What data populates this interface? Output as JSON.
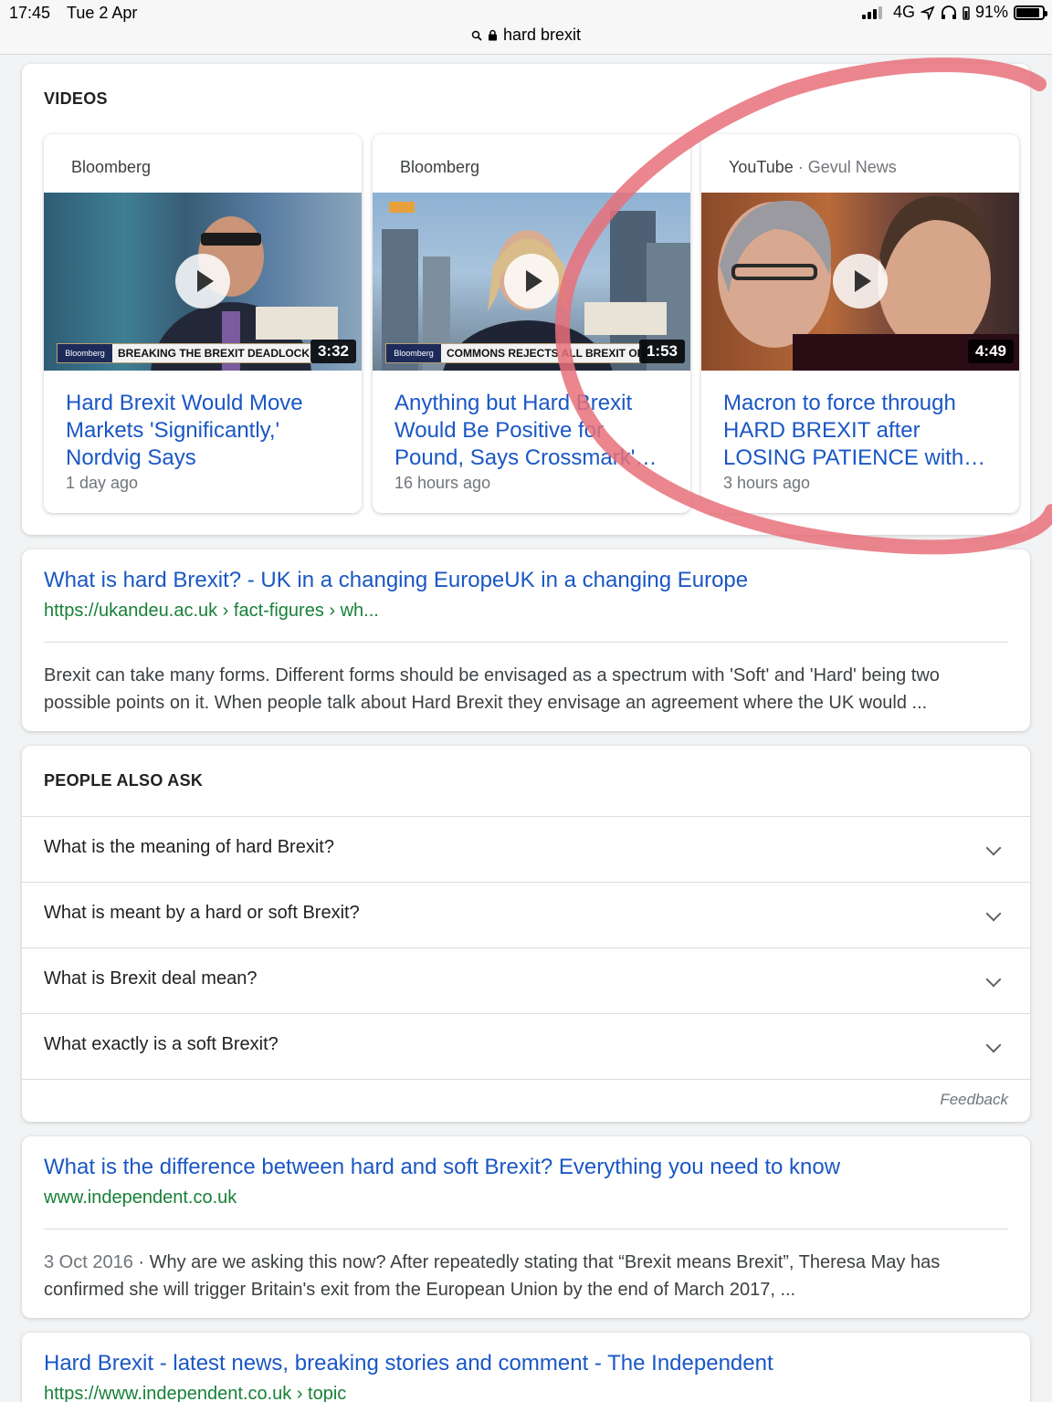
{
  "status_bar": {
    "time": "17:45",
    "date": "Tue 2 Apr",
    "network": "4G",
    "battery": "91%",
    "battery_level": 0.91
  },
  "address_bar": {
    "query": "hard brexit"
  },
  "videos": {
    "heading": "VIDEOS",
    "items": [
      {
        "source": "Bloomberg",
        "source_sub": "",
        "ticker": "BREAKING THE BREXIT DEADLOCK",
        "duration": "3:32",
        "title": "Hard Brexit Would Move Markets 'Significantly,' Nordvig Says",
        "age": "1 day ago"
      },
      {
        "source": "Bloomberg",
        "source_sub": "",
        "ticker": "COMMONS REJECTS ALL BREXIT OPT",
        "duration": "1:53",
        "title": "Anything but Hard Brexit Would Be Positive for Pound, Says Crossmark'…",
        "age": "16 hours ago"
      },
      {
        "source": "YouTube",
        "source_sub": " · Gevul News",
        "ticker": "",
        "duration": "4:49",
        "title": "Macron to force through HARD BREXIT after LOSING PATIENCE with…",
        "age": "3 hours ago"
      }
    ]
  },
  "result1": {
    "title": "What is hard Brexit? - UK in a changing EuropeUK in a changing Europe",
    "url": "https://ukandeu.ac.uk › fact-figures › wh...",
    "snippet": "Brexit can take many forms. Different forms should be envisaged as a spectrum with 'Soft' and 'Hard' being two possible points on it. When people talk about Hard Brexit they envisage an agreement where the UK would ..."
  },
  "people_also_ask": {
    "heading": "PEOPLE ALSO ASK",
    "questions": [
      "What is the meaning of hard Brexit?",
      "What is meant by a hard or soft Brexit?",
      "What is Brexit deal mean?",
      "What exactly is a soft Brexit?"
    ],
    "feedback": "Feedback"
  },
  "result2": {
    "title": "What is the difference between hard and soft Brexit? Everything you need to know",
    "url": "www.independent.co.uk",
    "date": "3 Oct 2016",
    "snippet": " · Why are we asking this now? After repeatedly stating that “Brexit means Brexit”, Theresa May has confirmed she will trigger Britain's exit from the European Union by the end of March 2017, ..."
  },
  "result3": {
    "title": "Hard Brexit - latest news, breaking stories and comment - The Independent",
    "url": "https://www.independent.co.uk › topic"
  },
  "colors": {
    "link": "#1a57c4",
    "url_green": "#188038",
    "annotation_red": "#e8707a"
  }
}
